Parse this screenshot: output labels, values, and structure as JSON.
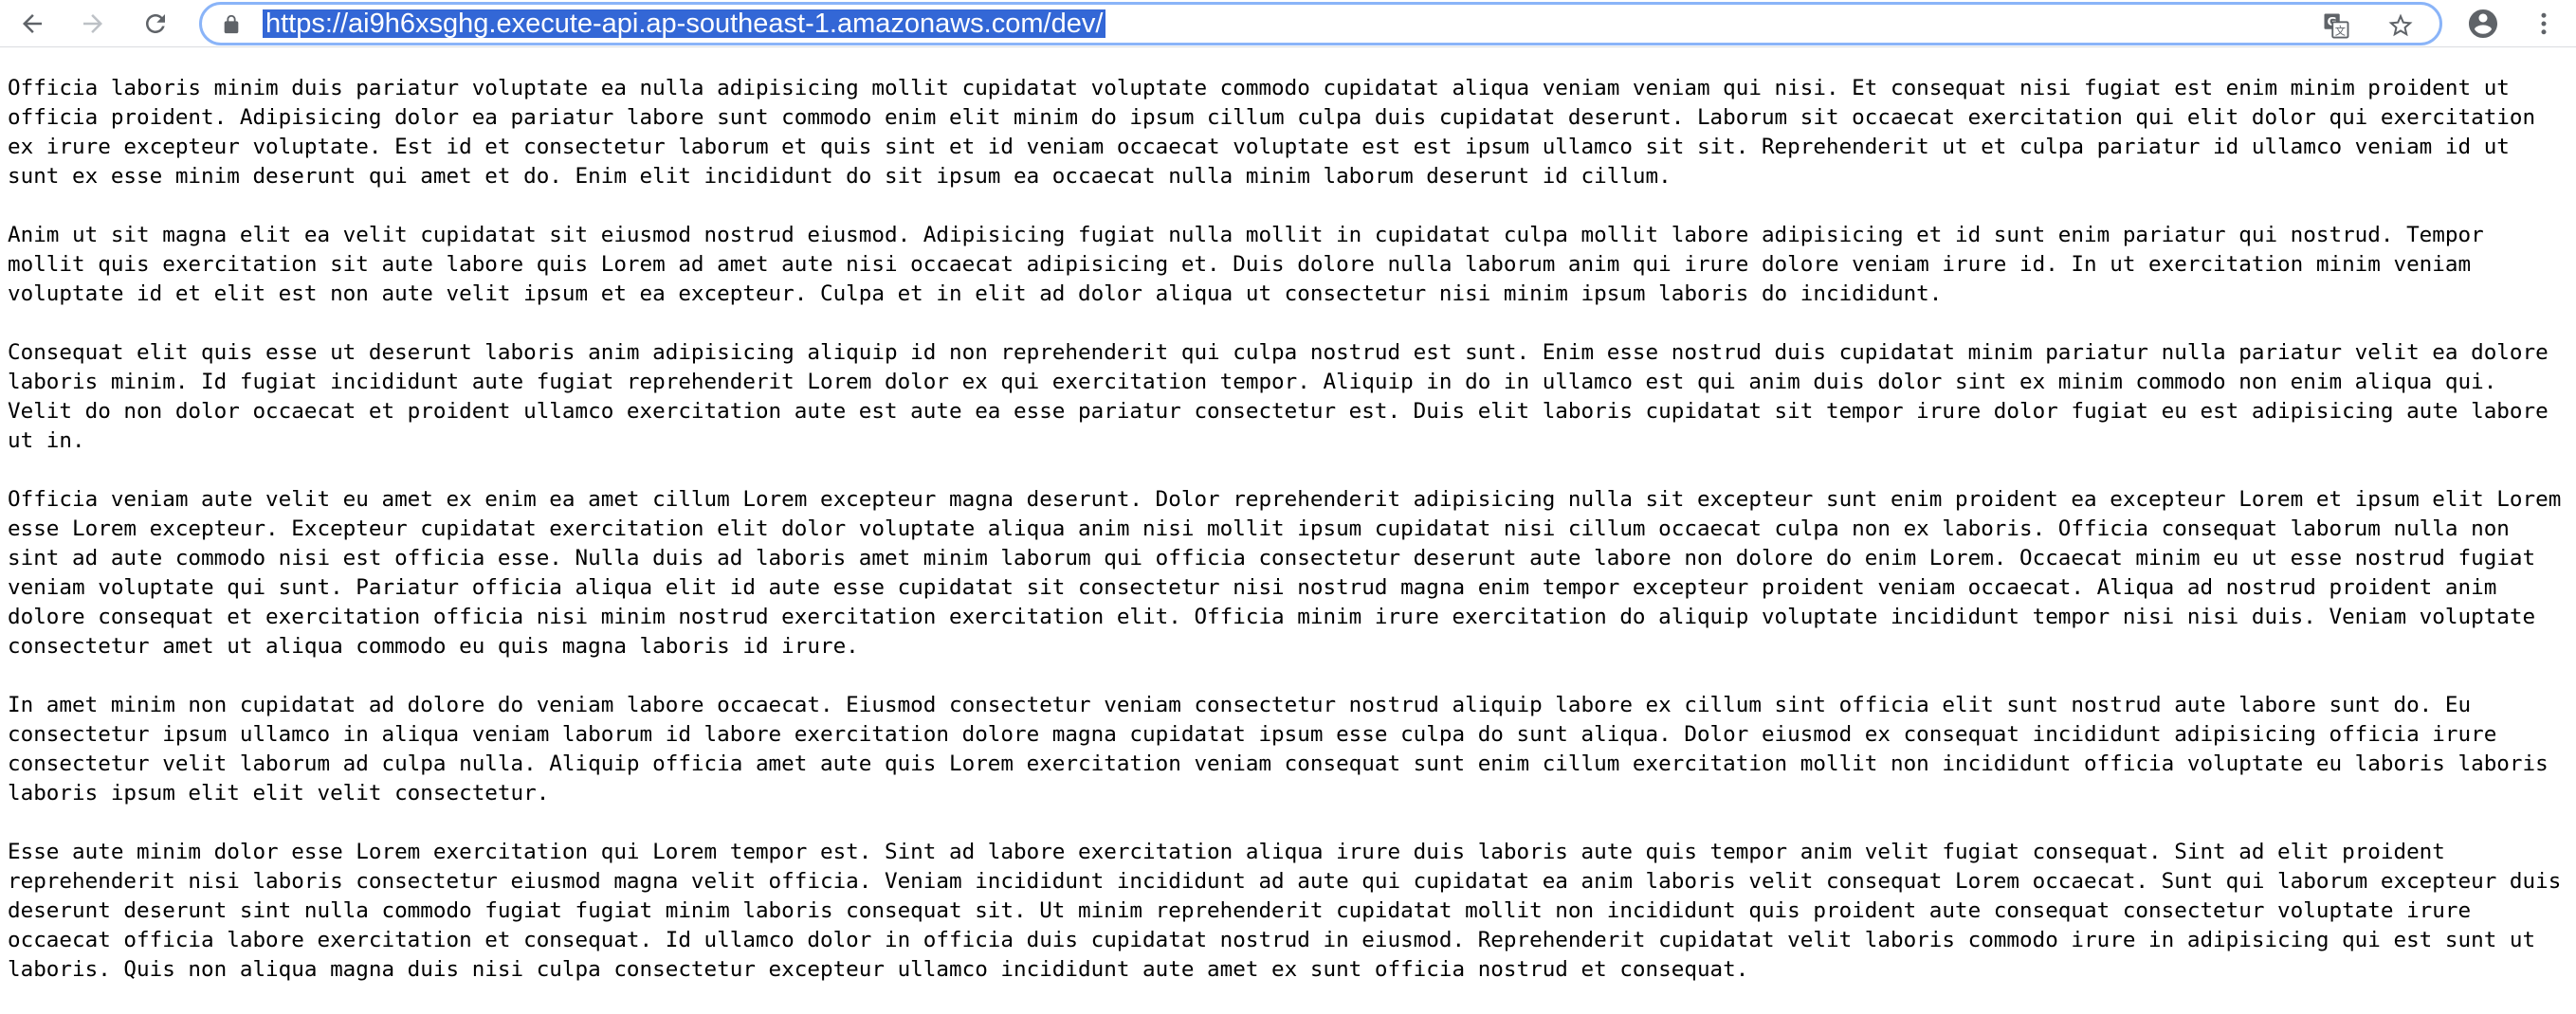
{
  "browser": {
    "url": "https://ai9h6xsghg.execute-api.ap-southeast-1.amazonaws.com/dev/",
    "icons": {
      "back": "arrow-left-icon",
      "forward": "arrow-right-icon",
      "reload": "reload-icon",
      "lock": "lock-icon",
      "translate": "translate-icon",
      "bookmark": "star-icon",
      "profile": "account-icon",
      "menu": "more-vert-icon"
    },
    "colors": {
      "url_highlight": "#3367d6",
      "omnibox_focus": "#8ab4f8",
      "icon": "#5f6368",
      "icon_disabled": "#bdc1c6"
    }
  },
  "paragraphs": [
    "Officia laboris minim duis pariatur voluptate ea nulla adipisicing mollit cupidatat voluptate commodo cupidatat aliqua veniam veniam qui nisi. Et consequat nisi fugiat est enim minim proident ut officia proident. Adipisicing dolor ea pariatur labore sunt commodo enim elit minim do ipsum cillum culpa duis cupidatat deserunt. Laborum sit occaecat exercitation qui elit dolor qui exercitation ex irure excepteur voluptate. Est id et consectetur laborum et quis sint et id veniam occaecat voluptate est est ipsum ullamco sit sit. Reprehenderit ut et culpa pariatur id ullamco veniam id ut sunt ex esse minim deserunt qui amet et do. Enim elit incididunt do sit ipsum ea occaecat nulla minim laborum deserunt id cillum.",
    "Anim ut sit magna elit ea velit cupidatat sit eiusmod nostrud eiusmod. Adipisicing fugiat nulla mollit in cupidatat culpa mollit labore adipisicing et id sunt enim pariatur qui nostrud. Tempor mollit quis exercitation sit aute labore quis Lorem ad amet aute nisi occaecat adipisicing et. Duis dolore nulla laborum anim qui irure dolore veniam irure id. In ut exercitation minim veniam voluptate id et elit est non aute velit ipsum et ea excepteur. Culpa et in elit ad dolor aliqua ut consectetur nisi minim ipsum laboris do incididunt.",
    "Consequat elit quis esse ut deserunt laboris anim adipisicing aliquip id non reprehenderit qui culpa nostrud est sunt. Enim esse nostrud duis cupidatat minim pariatur nulla pariatur velit ea dolore laboris minim. Id fugiat incididunt aute fugiat reprehenderit Lorem dolor ex qui exercitation tempor. Aliquip in do in ullamco est qui anim duis dolor sint ex minim commodo non enim aliqua qui. Velit do non dolor occaecat et proident ullamco exercitation aute est aute ea esse pariatur consectetur est. Duis elit laboris cupidatat sit tempor irure dolor fugiat eu est adipisicing aute labore ut in.",
    "Officia veniam aute velit eu amet ex enim ea amet cillum Lorem excepteur magna deserunt. Dolor reprehenderit adipisicing nulla sit excepteur sunt enim proident ea excepteur Lorem et ipsum elit Lorem esse Lorem excepteur. Excepteur cupidatat exercitation elit dolor voluptate aliqua anim nisi mollit ipsum cupidatat nisi cillum occaecat culpa non ex laboris. Officia consequat laborum nulla non sint ad aute commodo nisi est officia esse. Nulla duis ad laboris amet minim laborum qui officia consectetur deserunt aute labore non dolore do enim Lorem. Occaecat minim eu ut esse nostrud fugiat veniam voluptate qui sunt. Pariatur officia aliqua elit id aute esse cupidatat sit consectetur nisi nostrud magna enim tempor excepteur proident veniam occaecat. Aliqua ad nostrud proident anim dolore consequat et exercitation officia nisi minim nostrud exercitation exercitation elit. Officia minim irure exercitation do aliquip voluptate incididunt tempor nisi nisi duis. Veniam voluptate consectetur amet ut aliqua commodo eu quis magna laboris id irure.",
    "In amet minim non cupidatat ad dolore do veniam labore occaecat. Eiusmod consectetur veniam consectetur nostrud aliquip labore ex cillum sint officia elit sunt nostrud aute labore sunt do. Eu consectetur ipsum ullamco in aliqua veniam laborum id labore exercitation dolore magna cupidatat ipsum esse culpa do sunt aliqua. Dolor eiusmod ex consequat incididunt adipisicing officia irure consectetur velit laborum ad culpa nulla. Aliquip officia amet aute quis Lorem exercitation veniam consequat sunt enim cillum exercitation mollit non incididunt officia voluptate eu laboris laboris laboris ipsum elit elit velit consectetur.",
    "Esse aute minim dolor esse Lorem exercitation qui Lorem tempor est. Sint ad labore exercitation aliqua irure duis laboris aute quis tempor anim velit fugiat consequat. Sint ad elit proident reprehenderit nisi laboris consectetur eiusmod magna velit officia. Veniam incididunt incididunt ad aute qui cupidatat ea anim laboris velit consequat Lorem occaecat. Sunt qui laborum excepteur duis deserunt deserunt sint nulla commodo fugiat fugiat minim laboris consequat sit. Ut minim reprehenderit cupidatat mollit non incididunt quis proident aute consequat consectetur voluptate irure occaecat officia labore exercitation et consequat. Id ullamco dolor in officia duis cupidatat nostrud in eiusmod. Reprehenderit cupidatat velit laboris commodo irure in adipisicing qui est sunt ut laboris. Quis non aliqua magna duis nisi culpa consectetur excepteur ullamco incididunt aute amet ex sunt officia nostrud et consequat."
  ]
}
